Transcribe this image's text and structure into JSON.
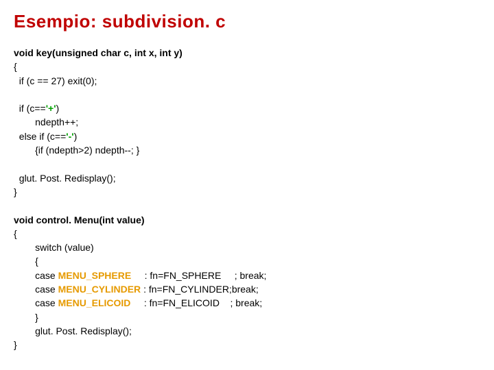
{
  "title": "Esempio: subdivision. c",
  "code": {
    "l01": "void key(unsigned char c, int x, int y)",
    "l02": "{",
    "l03": "  if (c == 27) exit(0);",
    "l04": "",
    "l05a": "  if (c==",
    "l05b": "'+'",
    "l05c": ")",
    "l06": "        ndepth++;",
    "l07a": "  else if (c==",
    "l07b": "'-'",
    "l07c": ")",
    "l08": "        {if (ndepth>2) ndepth--; }",
    "l09": "",
    "l10": "  glut. Post. Redisplay();",
    "l11": "}",
    "l12": "",
    "l13": "void control. Menu(int value)",
    "l14": "{",
    "l15": "        switch (value)",
    "l16": "        {",
    "l17a": "        case ",
    "l17b": "MENU_SPHERE",
    "l17c": "     : fn=FN_SPHERE     ; break;",
    "l18a": "        case ",
    "l18b": "MENU_CYLINDER ",
    "l18c": ": fn=FN_CYLINDER;break;",
    "l19a": "        case ",
    "l19b": "MENU_ELICOID",
    "l19c": "     : fn=FN_ELICOID    ; break;",
    "l20": "        }",
    "l21": "        glut. Post. Redisplay();",
    "l22": "}"
  }
}
